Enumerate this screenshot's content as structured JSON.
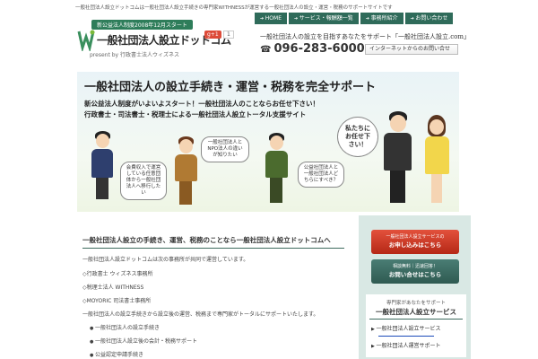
{
  "topline": "一般社団法人設立ドットコムは一般社団法人設立手続きの専門家WITHNESSが運営する一般社団法人の設立・運営・税務のサポートサイトです",
  "brand": {
    "badge": "新公益法人制度2008年12月スタート",
    "name": "一般社団法人設立ドットコム",
    "sub": "present by 行政書士法人ウィズネス",
    "gplus": "g+1",
    "gcount": "1"
  },
  "nav": [
    "HOME",
    "サービス・報酬額一覧",
    "事務所紹介",
    "お問い合わせ"
  ],
  "tagline": "一般社団法人の設立を目指すあなたをサポート「一般社団法人設立.com」",
  "phone": "096-283-6000",
  "internet_inquiry": "インターネットからのお問い合せ",
  "hero": {
    "title": "一般社団法人の設立手続き・運営・税務を完全サポート",
    "lines": [
      "新公益法人制度がいよいよスタート！一般社団法人のことならお任せ下さい！",
      "行政書士・司法書士・税理士による一般社団法人設立トータル支援サイト"
    ],
    "bubbles": {
      "a": "会費収入で運営している任意団体から一般社団法人へ移行したい",
      "b": "一般社団法人とNPO法人の違いが知りたい",
      "c": "公益社団法人と一般社団法人どちらにすべき？",
      "d": "私たちにお任せ下さい！"
    }
  },
  "content": {
    "title": "一般社団法人設立の手続き、運営、税務のことなら一般社団法人設立ドットコムへ",
    "intro": "一般社団法人設立ドットコムは次の事務所が共同で運営しています。",
    "d1": "◇行政書士 ウィズネス事務所",
    "d2": "◇税理士法人 WITHNESS",
    "d3": "◇MOYORIC 司法書士事務所",
    "d4": "一般社団法人の設立手続きから設立後の運営、税務まで専門家がトータルにサポートいたします。",
    "items": [
      "一般社団法人の設立手続き",
      "一般社団法人設立後の会計・税務サポート",
      "公益認定申請手続き"
    ]
  },
  "sidebar": {
    "apply_btn": {
      "line1": "一般社団法人設立サービスの",
      "line2": "お申し込みはこちら"
    },
    "contact_btn": {
      "line1": "相談無料｜迅速回答！",
      "line2": "お問い合せはこちら"
    },
    "box": {
      "kicker": "専門家があなたをサポート",
      "title": "一般社団法人設立サービス",
      "links": [
        "一般社団法人設立サービス",
        "一般社団法人運営サポート"
      ]
    }
  }
}
